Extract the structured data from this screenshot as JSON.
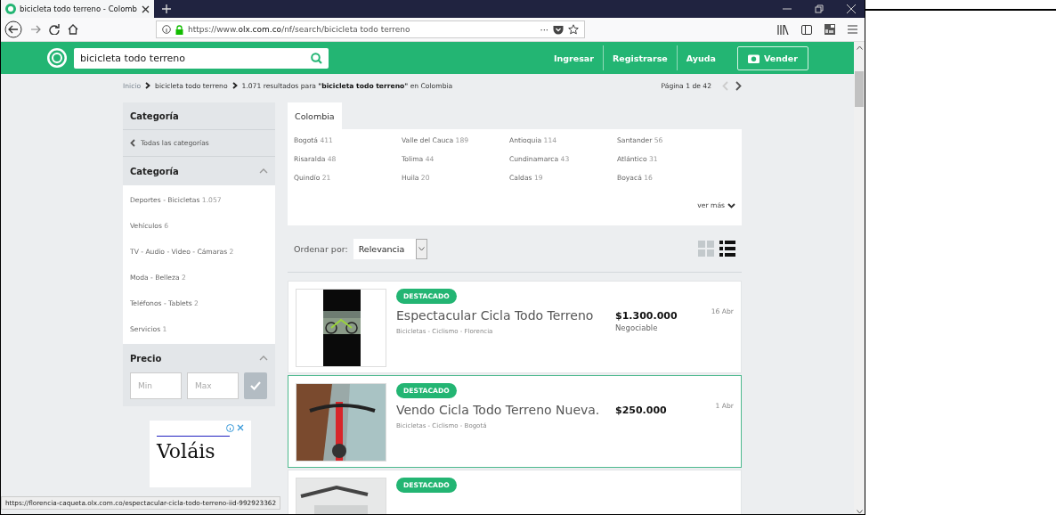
{
  "browser": {
    "tab_title": "bicicleta todo terreno - Colomb",
    "url_prefix": "https://www.",
    "url_domain": "olx.com.co",
    "url_path": "/nf/search/bicicleta todo terreno",
    "more": "···",
    "status_url": "https://florencia-caqueta.olx.com.co/espectacular-cicla-todo-terreno-iid-992923362"
  },
  "header": {
    "search_value": "bicicleta todo terreno",
    "links": [
      "Ingresar",
      "Registrarse",
      "Ayuda"
    ],
    "sell_button": "Vender"
  },
  "breadcrumb": {
    "items": [
      "Inicio",
      "bicicleta todo terreno"
    ],
    "results": "1.071 resultados para **\"bicicleta todo terreno\"** en Colombia",
    "page": "Página 1 de 42"
  },
  "sidebar": {
    "heading": "Categoría",
    "back_link": "Todas las categorías",
    "category": {
      "title": "Categoría",
      "expanded": true,
      "items": [
        {
          "name": "Deportes - Bicicletas",
          "count": "1.057"
        },
        {
          "name": "Vehículos",
          "count": "6"
        },
        {
          "name": "TV - Audio - Video - Cámaras",
          "count": "2"
        },
        {
          "name": "Moda - Belleza",
          "count": "2"
        },
        {
          "name": "Teléfonos - Tablets",
          "count": "2"
        },
        {
          "name": "Servicios",
          "count": "1"
        }
      ]
    },
    "price": {
      "title": "Precio",
      "expanded": true,
      "min_placeholder": "Min",
      "max_placeholder": "Max"
    },
    "ad": {
      "text": "Voláis"
    }
  },
  "locations": {
    "tab": "Colombia",
    "items": [
      {
        "name": "Bogotá",
        "count": "411"
      },
      {
        "name": "Valle del Cauca",
        "count": "189"
      },
      {
        "name": "Antioquia",
        "count": "114"
      },
      {
        "name": "Santander",
        "count": "56"
      },
      {
        "name": "Risaralda",
        "count": "48"
      },
      {
        "name": "Tolima",
        "count": "44"
      },
      {
        "name": "Cundinamarca",
        "count": "43"
      },
      {
        "name": "Atlántico",
        "count": "31"
      },
      {
        "name": "Quindío",
        "count": "21"
      },
      {
        "name": "Huila",
        "count": "20"
      },
      {
        "name": "Caldas",
        "count": "19"
      },
      {
        "name": "Boyacá",
        "count": "16"
      }
    ],
    "more": "ver más"
  },
  "sort": {
    "label": "Ordenar por:",
    "value": "Relevancia"
  },
  "views": [
    {
      "kind": "grid",
      "selected": false
    },
    {
      "kind": "list",
      "selected": true
    }
  ],
  "listings": [
    {
      "badge": "DESTACADO",
      "title": "Espectacular Cicla Todo Terreno",
      "category": "Bicicletas - Ciclismo - Florencia",
      "price": "$1.300.000",
      "note": "Negociable",
      "date": "16 Abr",
      "highlighted": false
    },
    {
      "badge": "DESTACADO",
      "title": "Vendo Cicla Todo Terreno Nueva.",
      "category": "Bicicletas - Ciclismo - Bogotá",
      "price": "$250.000",
      "date": "1 Abr",
      "highlighted": true
    },
    {
      "badge": "DESTACADO",
      "highlighted": false
    }
  ]
}
